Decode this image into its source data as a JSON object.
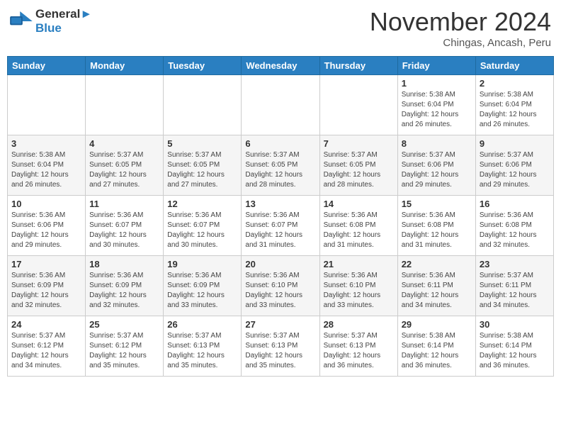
{
  "header": {
    "logo_line1": "General",
    "logo_line2": "Blue",
    "month": "November 2024",
    "location": "Chingas, Ancash, Peru"
  },
  "weekdays": [
    "Sunday",
    "Monday",
    "Tuesday",
    "Wednesday",
    "Thursday",
    "Friday",
    "Saturday"
  ],
  "weeks": [
    [
      {
        "day": "",
        "info": ""
      },
      {
        "day": "",
        "info": ""
      },
      {
        "day": "",
        "info": ""
      },
      {
        "day": "",
        "info": ""
      },
      {
        "day": "",
        "info": ""
      },
      {
        "day": "1",
        "info": "Sunrise: 5:38 AM\nSunset: 6:04 PM\nDaylight: 12 hours and 26 minutes."
      },
      {
        "day": "2",
        "info": "Sunrise: 5:38 AM\nSunset: 6:04 PM\nDaylight: 12 hours and 26 minutes."
      }
    ],
    [
      {
        "day": "3",
        "info": "Sunrise: 5:38 AM\nSunset: 6:04 PM\nDaylight: 12 hours and 26 minutes."
      },
      {
        "day": "4",
        "info": "Sunrise: 5:37 AM\nSunset: 6:05 PM\nDaylight: 12 hours and 27 minutes."
      },
      {
        "day": "5",
        "info": "Sunrise: 5:37 AM\nSunset: 6:05 PM\nDaylight: 12 hours and 27 minutes."
      },
      {
        "day": "6",
        "info": "Sunrise: 5:37 AM\nSunset: 6:05 PM\nDaylight: 12 hours and 28 minutes."
      },
      {
        "day": "7",
        "info": "Sunrise: 5:37 AM\nSunset: 6:05 PM\nDaylight: 12 hours and 28 minutes."
      },
      {
        "day": "8",
        "info": "Sunrise: 5:37 AM\nSunset: 6:06 PM\nDaylight: 12 hours and 29 minutes."
      },
      {
        "day": "9",
        "info": "Sunrise: 5:37 AM\nSunset: 6:06 PM\nDaylight: 12 hours and 29 minutes."
      }
    ],
    [
      {
        "day": "10",
        "info": "Sunrise: 5:36 AM\nSunset: 6:06 PM\nDaylight: 12 hours and 29 minutes."
      },
      {
        "day": "11",
        "info": "Sunrise: 5:36 AM\nSunset: 6:07 PM\nDaylight: 12 hours and 30 minutes."
      },
      {
        "day": "12",
        "info": "Sunrise: 5:36 AM\nSunset: 6:07 PM\nDaylight: 12 hours and 30 minutes."
      },
      {
        "day": "13",
        "info": "Sunrise: 5:36 AM\nSunset: 6:07 PM\nDaylight: 12 hours and 31 minutes."
      },
      {
        "day": "14",
        "info": "Sunrise: 5:36 AM\nSunset: 6:08 PM\nDaylight: 12 hours and 31 minutes."
      },
      {
        "day": "15",
        "info": "Sunrise: 5:36 AM\nSunset: 6:08 PM\nDaylight: 12 hours and 31 minutes."
      },
      {
        "day": "16",
        "info": "Sunrise: 5:36 AM\nSunset: 6:08 PM\nDaylight: 12 hours and 32 minutes."
      }
    ],
    [
      {
        "day": "17",
        "info": "Sunrise: 5:36 AM\nSunset: 6:09 PM\nDaylight: 12 hours and 32 minutes."
      },
      {
        "day": "18",
        "info": "Sunrise: 5:36 AM\nSunset: 6:09 PM\nDaylight: 12 hours and 32 minutes."
      },
      {
        "day": "19",
        "info": "Sunrise: 5:36 AM\nSunset: 6:09 PM\nDaylight: 12 hours and 33 minutes."
      },
      {
        "day": "20",
        "info": "Sunrise: 5:36 AM\nSunset: 6:10 PM\nDaylight: 12 hours and 33 minutes."
      },
      {
        "day": "21",
        "info": "Sunrise: 5:36 AM\nSunset: 6:10 PM\nDaylight: 12 hours and 33 minutes."
      },
      {
        "day": "22",
        "info": "Sunrise: 5:36 AM\nSunset: 6:11 PM\nDaylight: 12 hours and 34 minutes."
      },
      {
        "day": "23",
        "info": "Sunrise: 5:37 AM\nSunset: 6:11 PM\nDaylight: 12 hours and 34 minutes."
      }
    ],
    [
      {
        "day": "24",
        "info": "Sunrise: 5:37 AM\nSunset: 6:12 PM\nDaylight: 12 hours and 34 minutes."
      },
      {
        "day": "25",
        "info": "Sunrise: 5:37 AM\nSunset: 6:12 PM\nDaylight: 12 hours and 35 minutes."
      },
      {
        "day": "26",
        "info": "Sunrise: 5:37 AM\nSunset: 6:13 PM\nDaylight: 12 hours and 35 minutes."
      },
      {
        "day": "27",
        "info": "Sunrise: 5:37 AM\nSunset: 6:13 PM\nDaylight: 12 hours and 35 minutes."
      },
      {
        "day": "28",
        "info": "Sunrise: 5:37 AM\nSunset: 6:13 PM\nDaylight: 12 hours and 36 minutes."
      },
      {
        "day": "29",
        "info": "Sunrise: 5:38 AM\nSunset: 6:14 PM\nDaylight: 12 hours and 36 minutes."
      },
      {
        "day": "30",
        "info": "Sunrise: 5:38 AM\nSunset: 6:14 PM\nDaylight: 12 hours and 36 minutes."
      }
    ]
  ]
}
